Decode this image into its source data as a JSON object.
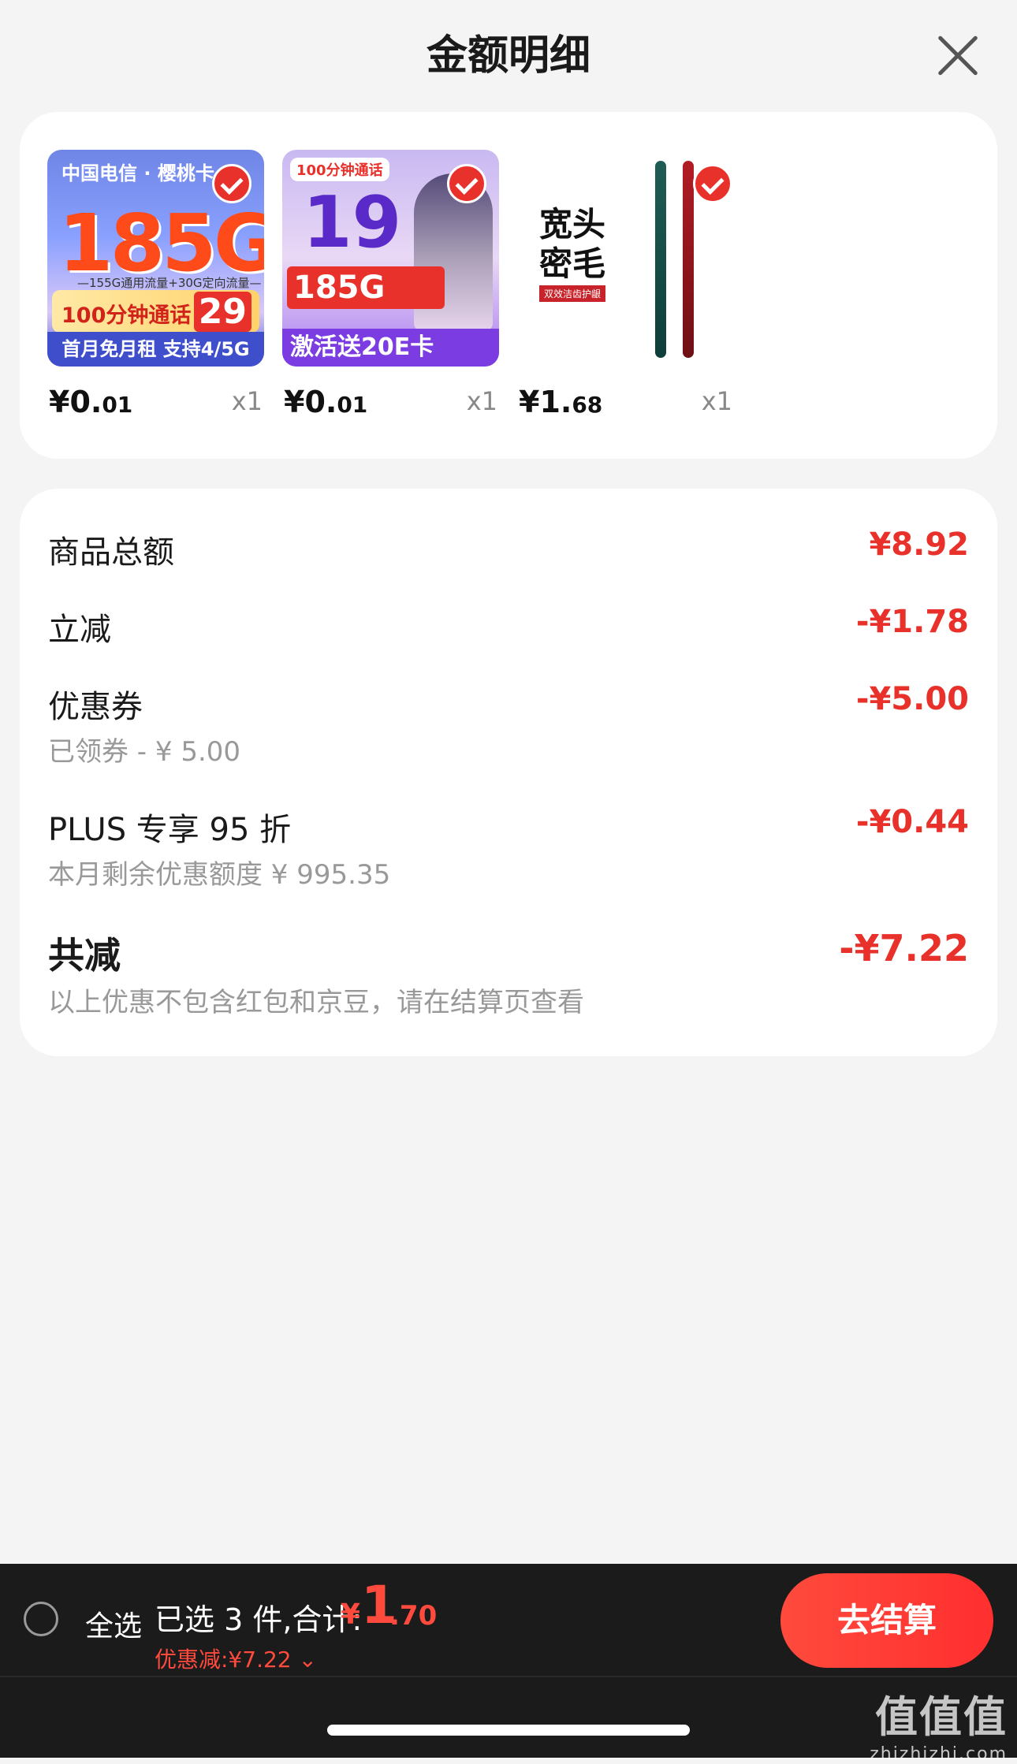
{
  "header": {
    "title": "金额明细"
  },
  "products": [
    {
      "price_main": "¥0.",
      "price_dec": "01",
      "qty": "x1",
      "img": {
        "logo": "中国电信 · 樱桃卡",
        "big": "185G",
        "sub": "—155G通用流量+30G定向流量—",
        "band": "100分钟通话",
        "band_price": "29",
        "foot": "首月免月租 支持4/5G"
      }
    },
    {
      "price_main": "¥0.",
      "price_dec": "01",
      "qty": "x1",
      "img": {
        "head": "100分钟通话",
        "big": "19",
        "red": "185G",
        "foot": "激活送20E卡"
      }
    },
    {
      "price_main": "¥1.",
      "price_dec": "68",
      "qty": "x1",
      "img": {
        "line1": "宽头",
        "line2": "密毛",
        "tag": "双效洁齿护龈"
      }
    }
  ],
  "summary": {
    "total_label": "商品总额",
    "total_value": "¥8.92",
    "instant_label": "立减",
    "instant_value": "-¥1.78",
    "coupon_label": "优惠券",
    "coupon_value": "-¥5.00",
    "coupon_sub": "已领券 - ¥ 5.00",
    "plus_label": "PLUS 专享 95 折",
    "plus_value": "-¥0.44",
    "plus_sub": "本月剩余优惠额度 ¥ 995.35",
    "saved_label": "共减",
    "saved_value": "-¥7.22",
    "saved_sub": "以上优惠不包含红包和京豆，请在结算页查看"
  },
  "bottom": {
    "select_all": "全选",
    "selected_text": "已选 3 件,合计:",
    "total_yen": "¥",
    "total_int": "1",
    "total_dec": ".70",
    "discount": "优惠减:¥7.22 ⌄",
    "checkout": "去结算"
  },
  "watermark": {
    "line1": "值值值",
    "line2": "zhizhizhi.com"
  }
}
